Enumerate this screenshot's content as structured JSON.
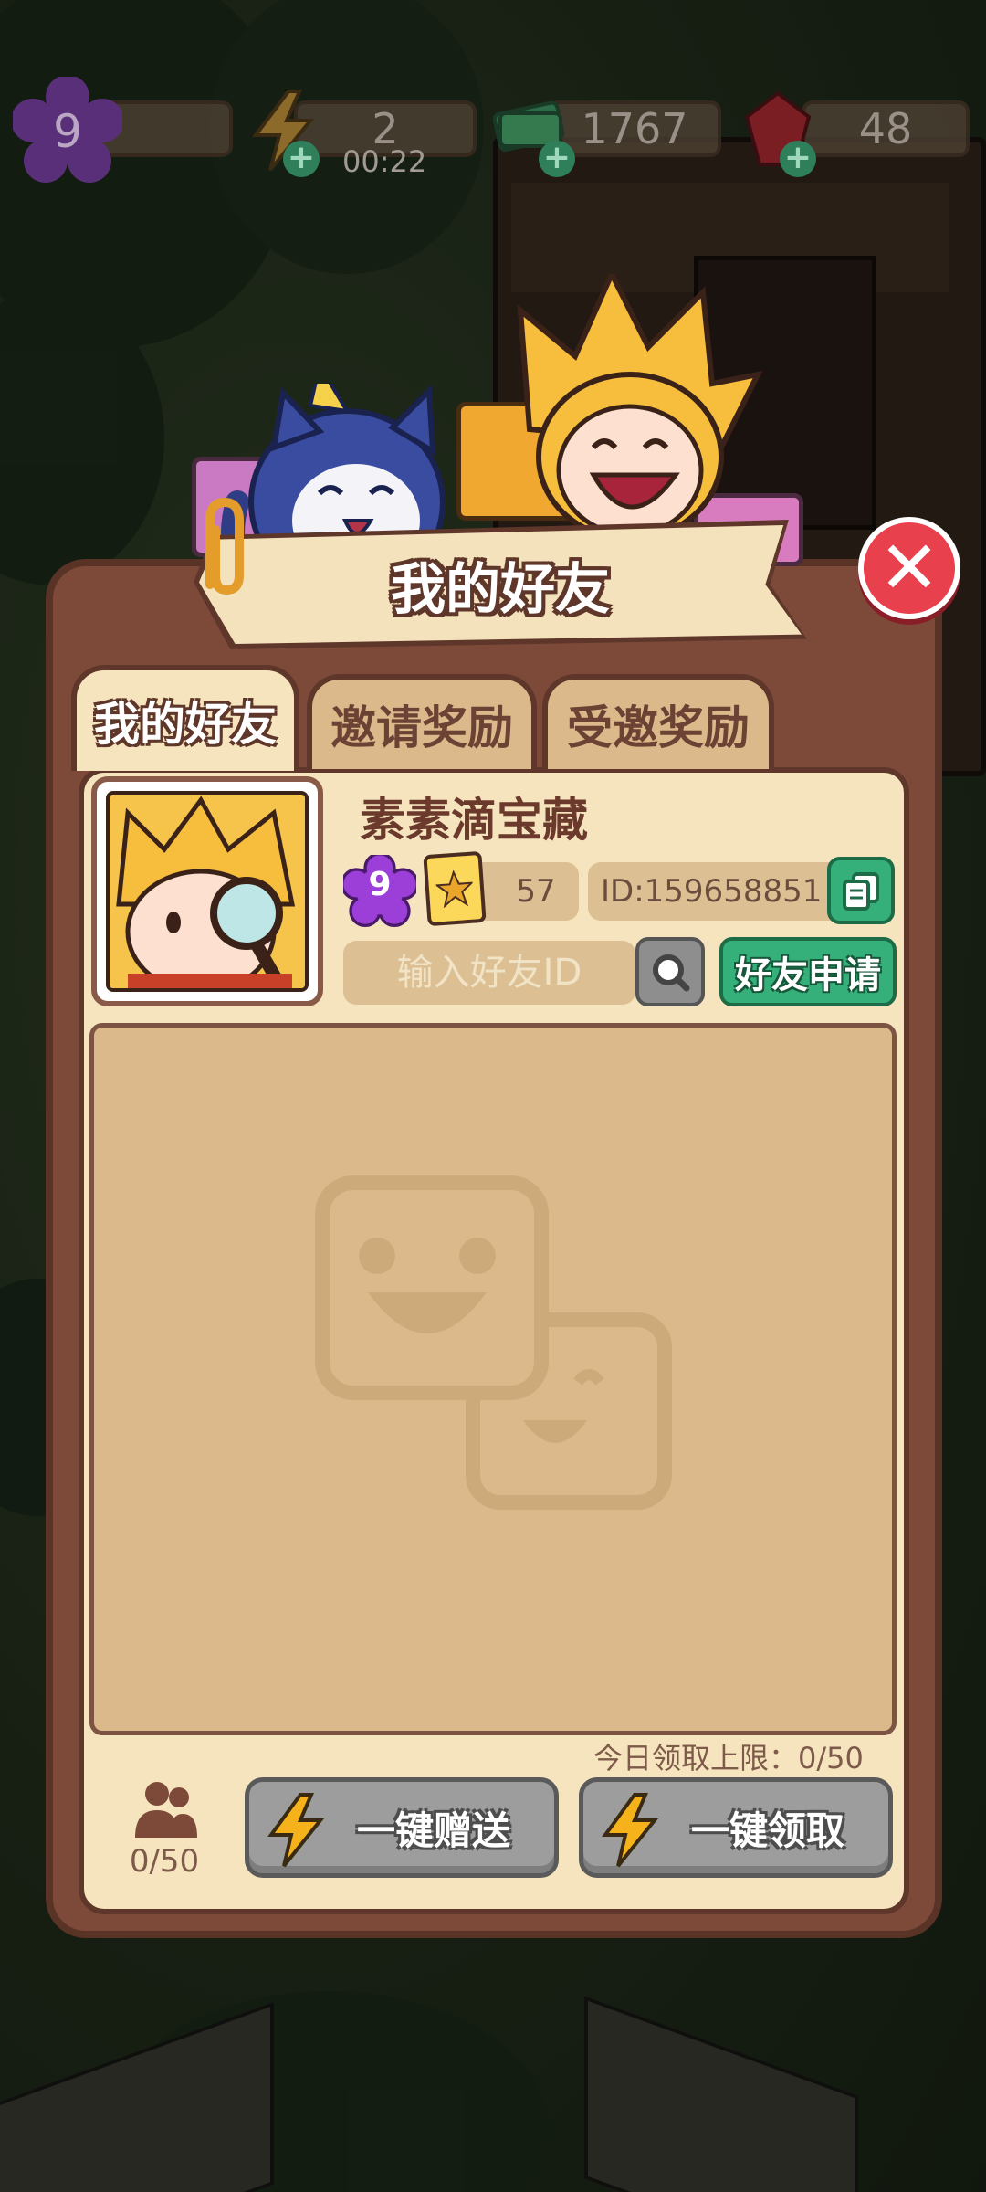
{
  "hud": {
    "level": "9",
    "energy": "2",
    "energy_timer": "00:22",
    "cash": "1767",
    "gems": "48"
  },
  "modal": {
    "title": "我的好友",
    "tabs": [
      {
        "label": "我的好友",
        "active": true
      },
      {
        "label": "邀请奖励",
        "active": false
      },
      {
        "label": "受邀奖励",
        "active": false
      }
    ],
    "profile": {
      "name": "素素滴宝藏",
      "level": "9",
      "stars": "57",
      "id_text": "ID:159658851"
    },
    "search": {
      "placeholder": "输入好友ID",
      "apply_label": "好友申请"
    },
    "footer": {
      "daily_limit": "今日领取上限：0/50",
      "friend_count": "0/50",
      "send_all_label": "一键赠送",
      "claim_all_label": "一键领取"
    }
  },
  "colors": {
    "panel": "#7d4a3a",
    "panel_light": "#f5e4bd",
    "accent_green": "#36b07a",
    "close_red": "#e8404d",
    "disabled_gray": "#9d9d9d"
  }
}
